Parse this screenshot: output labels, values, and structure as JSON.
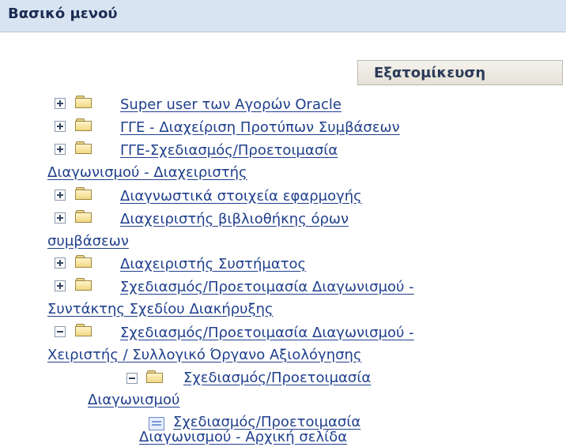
{
  "header": {
    "title": "Βασικό μενού"
  },
  "actions": {
    "personalize_label": "Εξατομίκευση"
  },
  "menu": {
    "items": [
      {
        "label_line1": "Super user των Αγορών Oracle",
        "label_line2": "",
        "state": "collapsed",
        "icon": "folder-icon"
      },
      {
        "label_line1": "ΓΓΕ - Διαχείριση Προτύπων Συμβάσεων",
        "label_line2": "",
        "state": "collapsed",
        "icon": "folder-icon"
      },
      {
        "label_line1": "ΓΓΕ-Σχεδιασμός/Προετοιμασία",
        "label_line2": "Διαγωνισμού - Διαχειριστής",
        "state": "collapsed",
        "icon": "folder-icon"
      },
      {
        "label_line1": "Διαγνωστικά στοιχεία εφαρμογής",
        "label_line2": "",
        "state": "collapsed",
        "icon": "folder-icon"
      },
      {
        "label_line1": "Διαχειριστής βιβλιοθήκης όρων",
        "label_line2": "συμβάσεων",
        "state": "collapsed",
        "icon": "folder-icon"
      },
      {
        "label_line1": "Διαχειριστής Συστήματος",
        "label_line2": "",
        "state": "collapsed",
        "icon": "folder-icon"
      },
      {
        "label_line1": "Σχεδιασμός/Προετοιμασία Διαγωνισμού -",
        "label_line2": "Συντάκτης Σχεδίου Διακήρυξης",
        "state": "collapsed",
        "icon": "folder-icon"
      },
      {
        "label_line1": "Σχεδιασμός/Προετοιμασία Διαγωνισμού -",
        "label_line2": "Χειριστής / Συλλογικό Όργανο Αξιολόγησης",
        "state": "expanded",
        "icon": "folder-icon"
      }
    ],
    "subfolder": {
      "label_line1": "Σχεδιασμός/Προετοιμασία",
      "label_line2": "Διαγωνισμού",
      "state": "expanded",
      "icon": "folder-icon"
    },
    "leaf": {
      "label_line1": "Σχεδιασμός/Προετοιμασία",
      "label_line2": "Διαγωνισμού - Αρχική σελίδα",
      "icon": "document-icon"
    }
  }
}
